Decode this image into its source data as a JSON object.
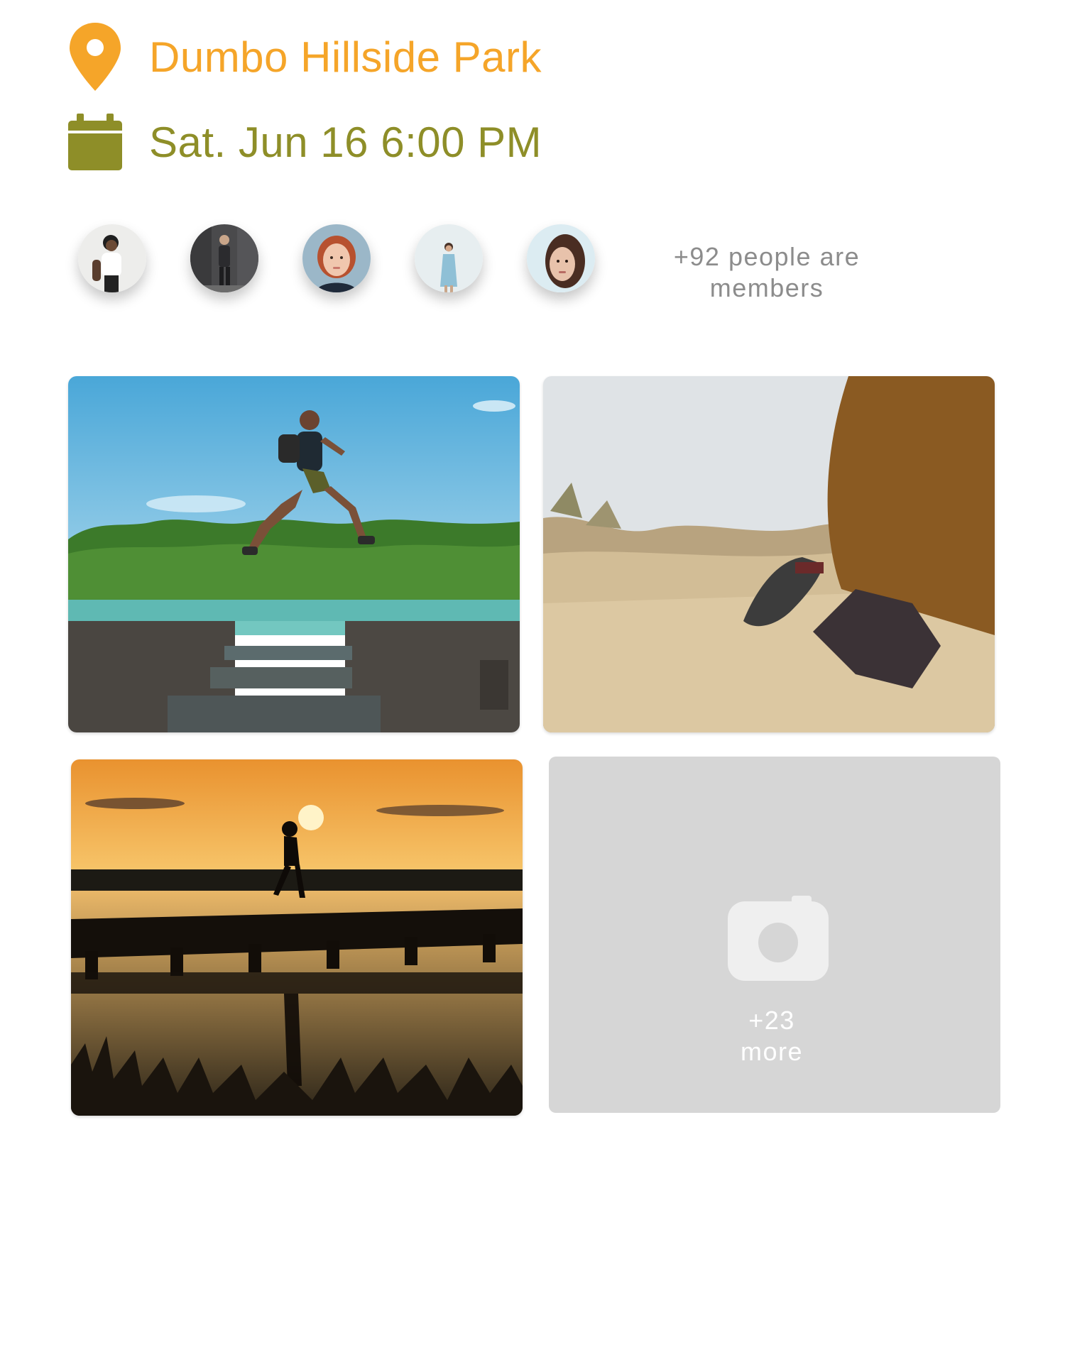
{
  "event": {
    "location": "Dumbo Hillside Park",
    "datetime": "Sat. Jun 16 6:00 PM",
    "location_icon": "map-pin-icon",
    "date_icon": "calendar-icon"
  },
  "members": {
    "avatars": [
      {
        "name": "member-avatar-1"
      },
      {
        "name": "member-avatar-2"
      },
      {
        "name": "member-avatar-3"
      },
      {
        "name": "member-avatar-4"
      },
      {
        "name": "member-avatar-5"
      }
    ],
    "count_line1": "+92 people are",
    "count_line2": "members"
  },
  "photos": {
    "more_count": "+23",
    "more_label": "more",
    "more_icon": "camera-icon"
  },
  "colors": {
    "location_accent": "#F5A529",
    "date_accent": "#8E8E28",
    "tile_gray": "#D6D6D6"
  }
}
